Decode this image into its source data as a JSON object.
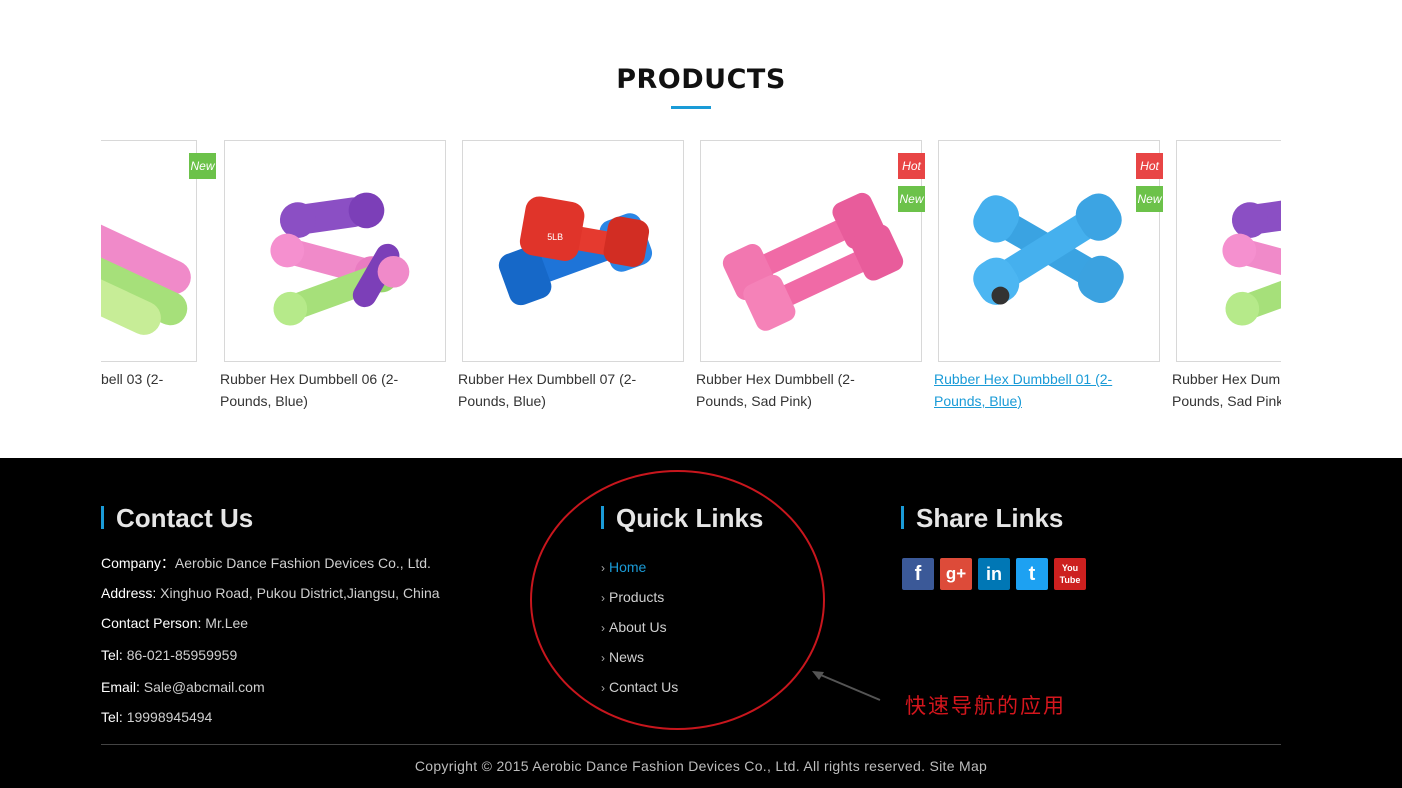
{
  "products": {
    "title": "PRODUCTS",
    "items": [
      {
        "name": "bell 03 (2-",
        "badges": [
          "New"
        ],
        "color": "pink-green"
      },
      {
        "name": "Rubber Hex Dumbbell 06 (2-Pounds, Blue)",
        "badges": [],
        "color": "multi"
      },
      {
        "name": "Rubber Hex Dumbbell 07 (2-Pounds, Blue)",
        "badges": [],
        "color": "red-blue"
      },
      {
        "name": "Rubber Hex Dumbbell (2-Pounds, Sad Pink)",
        "badges": [
          "Hot",
          "New"
        ],
        "color": "pink"
      },
      {
        "name": "Rubber Hex Dumbbell 01 (2-Pounds, Blue)",
        "badges": [
          "Hot",
          "New"
        ],
        "color": "blue",
        "hovered": true
      },
      {
        "name": "Rubber Hex Dumbbell (2-Pounds, Sad Pink",
        "badges": [],
        "color": "multi"
      }
    ]
  },
  "footer": {
    "contact": {
      "title": "Contact Us",
      "lines": [
        {
          "label": "Company：",
          "value": "Aerobic Dance Fashion Devices Co., Ltd."
        },
        {
          "label": "Address: ",
          "value": "Xinghuo Road, Pukou District,Jiangsu, China"
        },
        {
          "label": "Contact Person: ",
          "value": "Mr.Lee"
        },
        {
          "label": "Tel: ",
          "value": "86-021-85959959"
        },
        {
          "label": "Email: ",
          "value": "Sale@abcmail.com"
        },
        {
          "label": "Tel: ",
          "value": "19998945494"
        }
      ]
    },
    "quick_links": {
      "title": "Quick Links",
      "arrow": "›",
      "items": [
        "Home",
        "Products",
        "About Us",
        "News",
        "Contact Us"
      ]
    },
    "share": {
      "title": "Share Links",
      "icons": [
        {
          "name": "facebook-icon",
          "glyph": "f"
        },
        {
          "name": "google-plus-icon",
          "glyph": "g+"
        },
        {
          "name": "linkedin-icon",
          "glyph": "in"
        },
        {
          "name": "twitter-icon",
          "glyph": "t"
        },
        {
          "name": "youtube-icon",
          "glyph": "You Tube"
        }
      ]
    },
    "copyright": "Copyright © 2015 Aerobic Dance Fashion Devices Co., Ltd. All rights reserved.",
    "site_map": "Site Map"
  },
  "annotation": {
    "text": "快速导航的应用",
    "color": "#d4161d"
  }
}
